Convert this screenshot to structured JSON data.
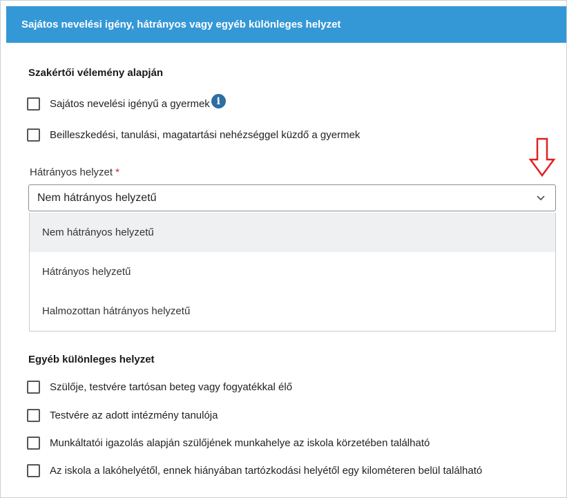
{
  "panel": {
    "title": "Sajátos nevelési igény, hátrányos vagy egyéb különleges helyzet"
  },
  "expert_section": {
    "title": "Szakértői vélemény alapján",
    "checkboxes": [
      "Sajátos nevelési igényű a gyermek",
      "Beilleszkedési, tanulási, magatartási nehézséggel küzdő a gyermek"
    ],
    "info_icon_glyph": "i"
  },
  "disadvantage_field": {
    "label": "Hátrányos helyzet",
    "required_marker": "*",
    "selected_value": "Nem hátrányos helyzetű",
    "options": [
      "Nem hátrányos helyzetű",
      "Hátrányos helyzetű",
      "Halmozottan hátrányos helyzetű"
    ],
    "expanded": true
  },
  "other_section": {
    "title": "Egyéb különleges helyzet",
    "checkboxes": [
      "Szülője, testvére tartósan beteg vagy fogyatékkal élő",
      "Testvére az adott intézmény tanulója",
      "Munkáltatói igazolás alapján szülőjének munkahelye az iskola körzetében található",
      "Az iskola a lakóhelyétől, ennek hiányában tartózkodási helyétől egy kilométeren belül található"
    ]
  },
  "colors": {
    "header_bg": "#3598d6",
    "annotation_arrow": "#e02020",
    "selected_option_bg": "#eef0f1",
    "info_icon": "#2d6ea3"
  },
  "icons": {
    "info": "info-icon",
    "chevron": "chevron-down-icon",
    "annotation": "red-down-arrow-icon"
  }
}
